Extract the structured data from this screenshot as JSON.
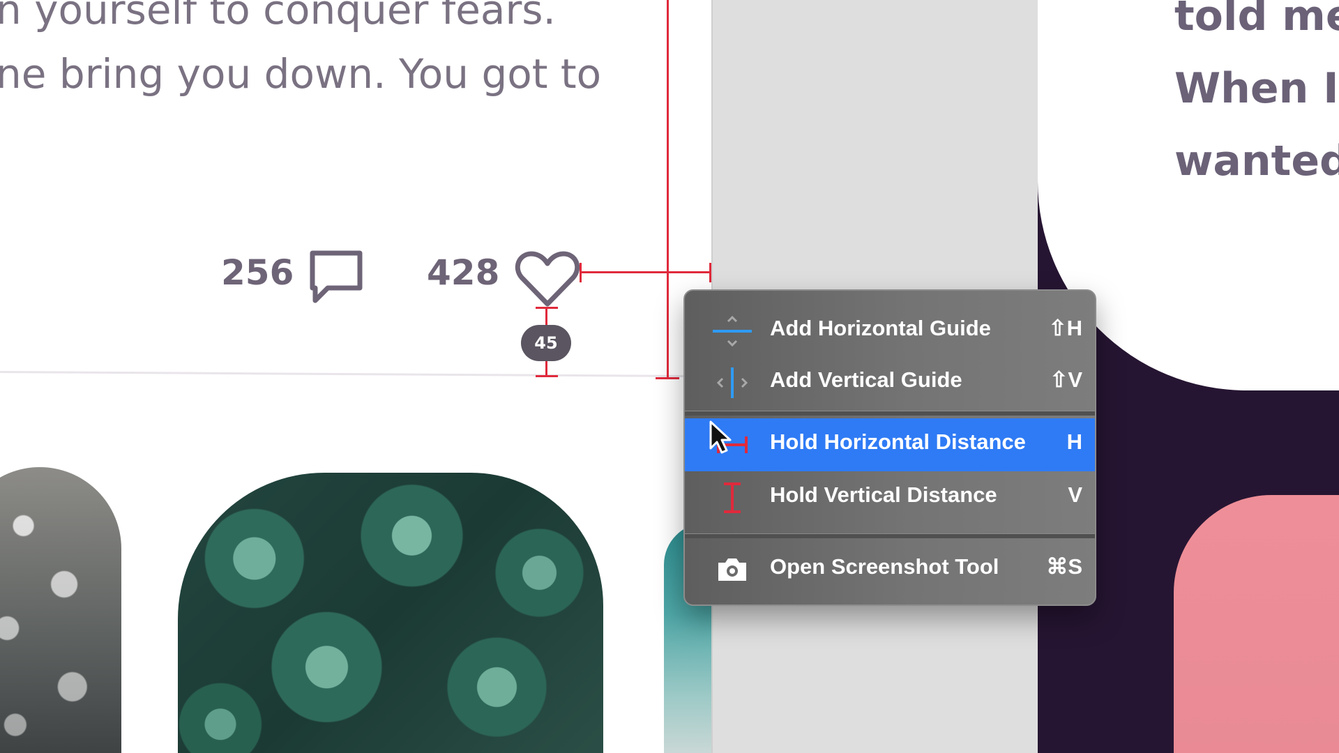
{
  "post": {
    "quote_line_1": "n yourself to conquer fears.",
    "quote_line_2": "ne bring you down. You got to",
    "comment_count": "256",
    "like_count": "428"
  },
  "measurement": {
    "distance_badge": "45"
  },
  "side_card": {
    "line_1": "told me",
    "line_2": "When I",
    "line_3": "wanted"
  },
  "context_menu": {
    "items": [
      {
        "label": "Add Horizontal Guide",
        "shortcut": "⇧H",
        "icon": "horizontal-guide-icon",
        "selected": false
      },
      {
        "label": "Add Vertical Guide",
        "shortcut": "⇧V",
        "icon": "vertical-guide-icon",
        "selected": false
      },
      {
        "label": "Hold Horizontal Distance",
        "shortcut": "H",
        "icon": "horizontal-distance-icon",
        "selected": true
      },
      {
        "label": "Hold Vertical Distance",
        "shortcut": "V",
        "icon": "vertical-distance-icon",
        "selected": false
      },
      {
        "label": "Open Screenshot Tool",
        "shortcut": "⌘S",
        "icon": "camera-icon",
        "selected": false
      }
    ]
  },
  "colors": {
    "accent_blue": "#2f7bf5",
    "measure_red": "#e02a3c",
    "dark_panel": "#261532",
    "text_muted": "#7a7282"
  }
}
